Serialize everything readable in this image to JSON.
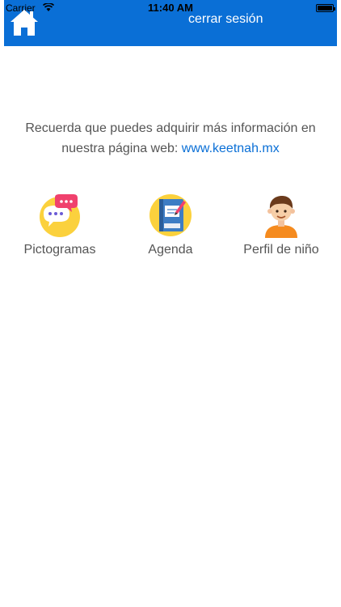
{
  "status_bar": {
    "carrier": "Carrier",
    "time": "11:40 AM"
  },
  "header": {
    "background_color": "#0a6fd6",
    "logout_label": "cerrar sesión",
    "home_icon": "home-icon"
  },
  "info": {
    "text": "Recuerda que puedes adquirir más información en nuestra página web: ",
    "link_text": "www.keetnah.mx",
    "link_color": "#0a6fd6"
  },
  "menu": {
    "items": [
      {
        "label": "Pictogramas",
        "icon": "chat-bubbles-icon"
      },
      {
        "label": "Agenda",
        "icon": "notebook-icon"
      },
      {
        "label": "Perfil de niño",
        "icon": "boy-avatar-icon"
      }
    ]
  }
}
